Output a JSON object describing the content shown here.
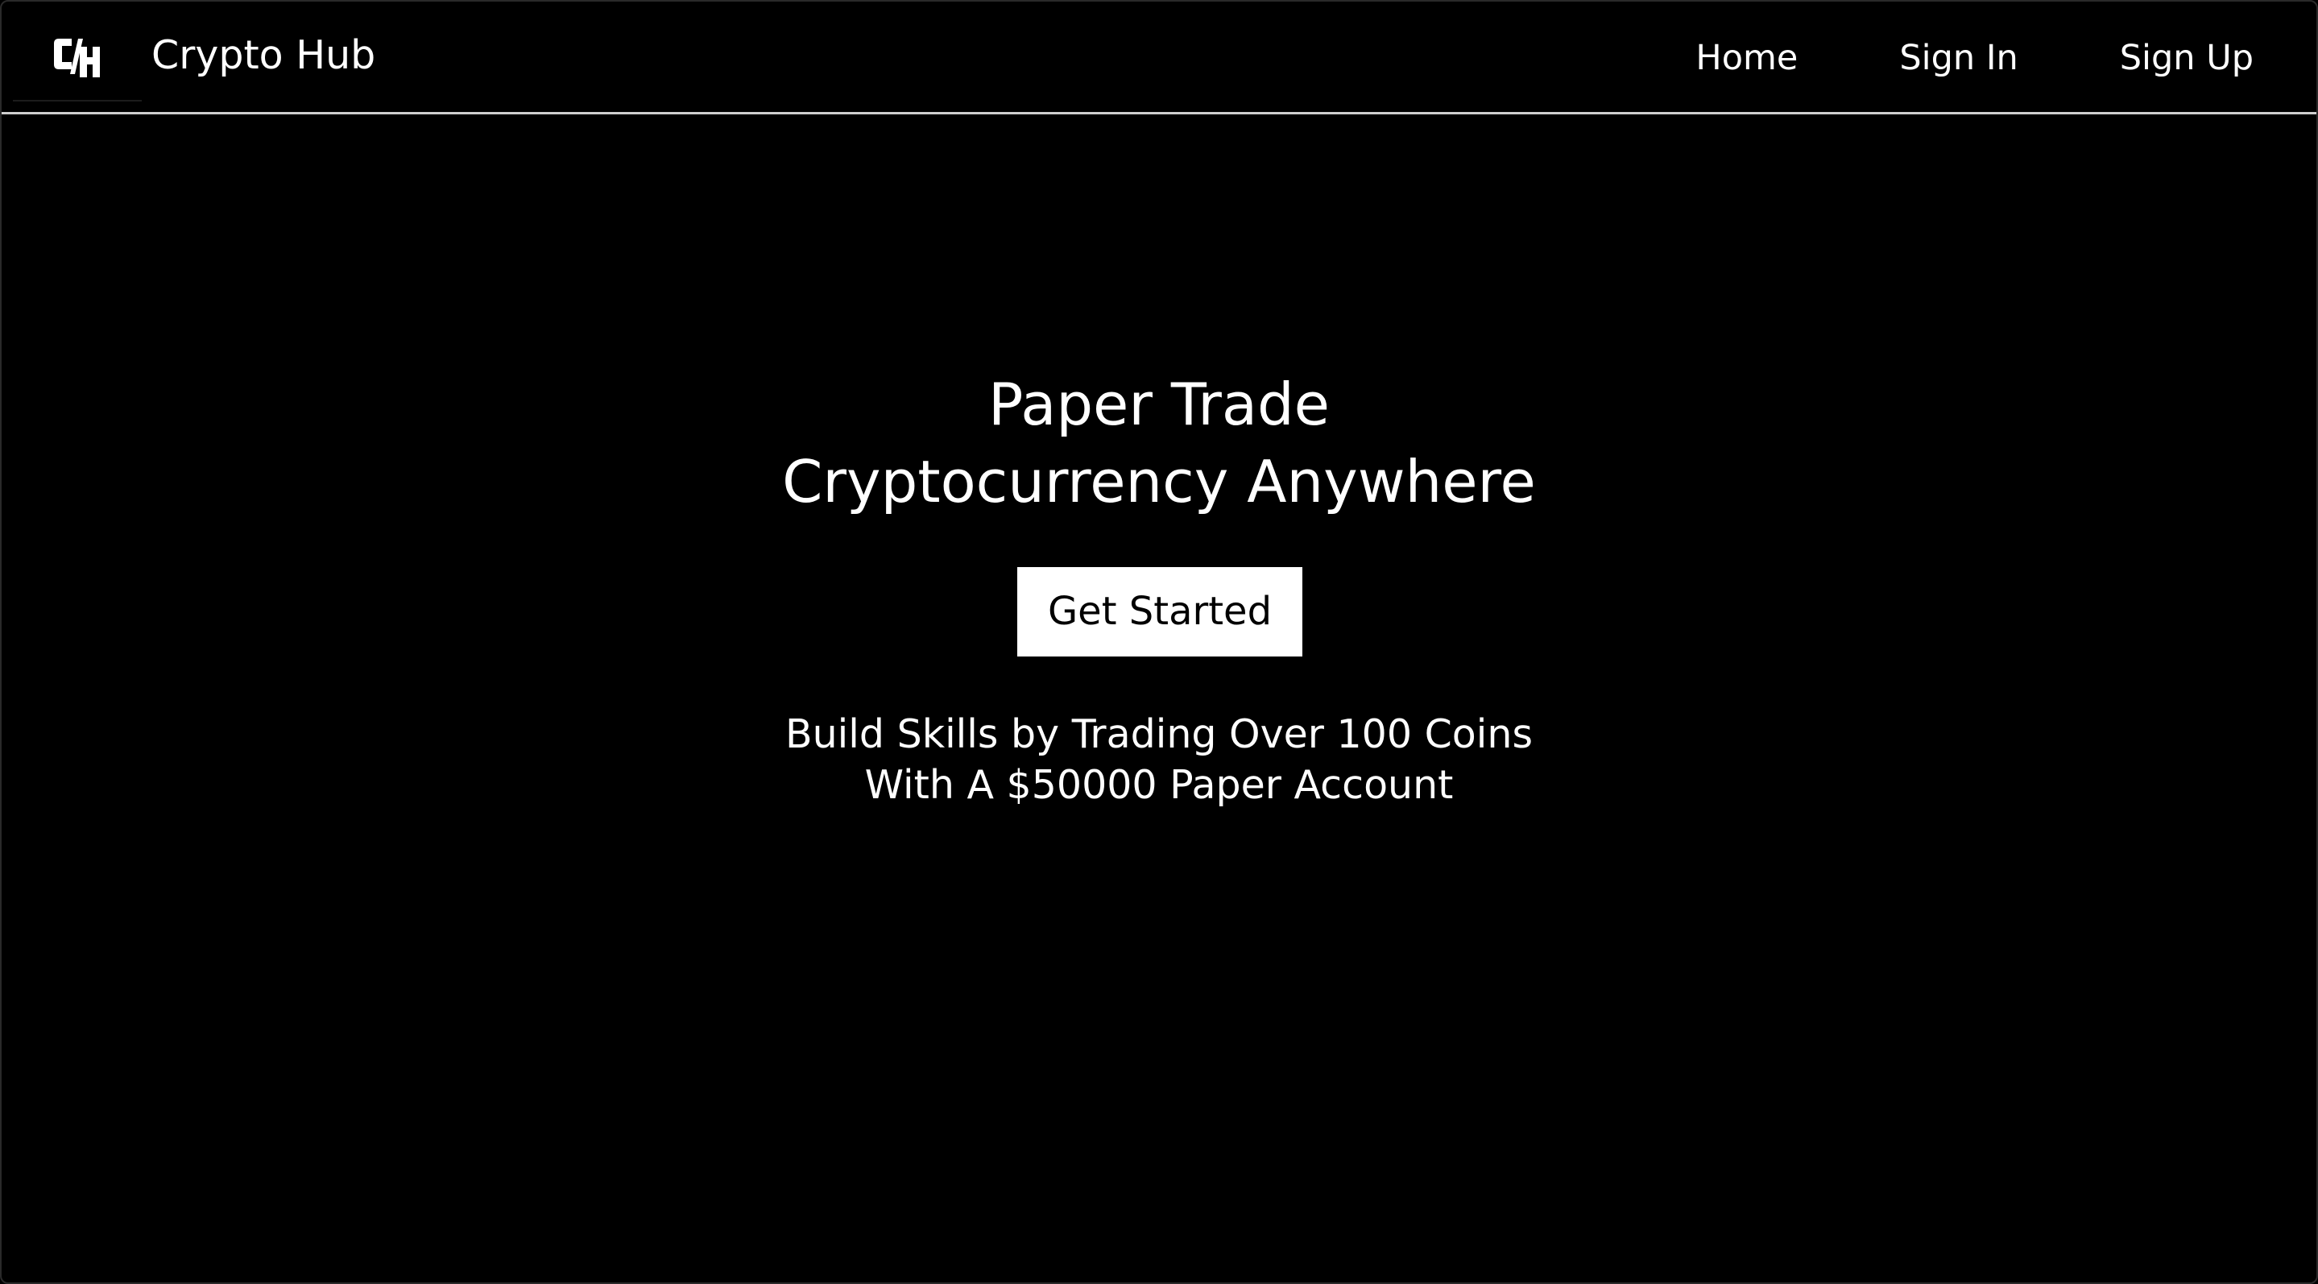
{
  "header": {
    "logo_icon": "crypto-hub-logo-icon",
    "logo_text": "CH",
    "brand": "Crypto Hub",
    "nav": [
      {
        "label": "Home"
      },
      {
        "label": "Sign In"
      },
      {
        "label": "Sign Up"
      }
    ]
  },
  "hero": {
    "headline_line1": "Paper Trade",
    "headline_line2": "Cryptocurrency Anywhere",
    "cta_label": "Get Started",
    "subtext_line1": "Build Skills by Trading Over 100 Coins",
    "subtext_line2": "With A $50000 Paper Account"
  },
  "colors": {
    "background": "#000000",
    "text": "#ffffff",
    "button_bg": "#ffffff",
    "button_text": "#000000",
    "divider": "#cfcfcf"
  }
}
